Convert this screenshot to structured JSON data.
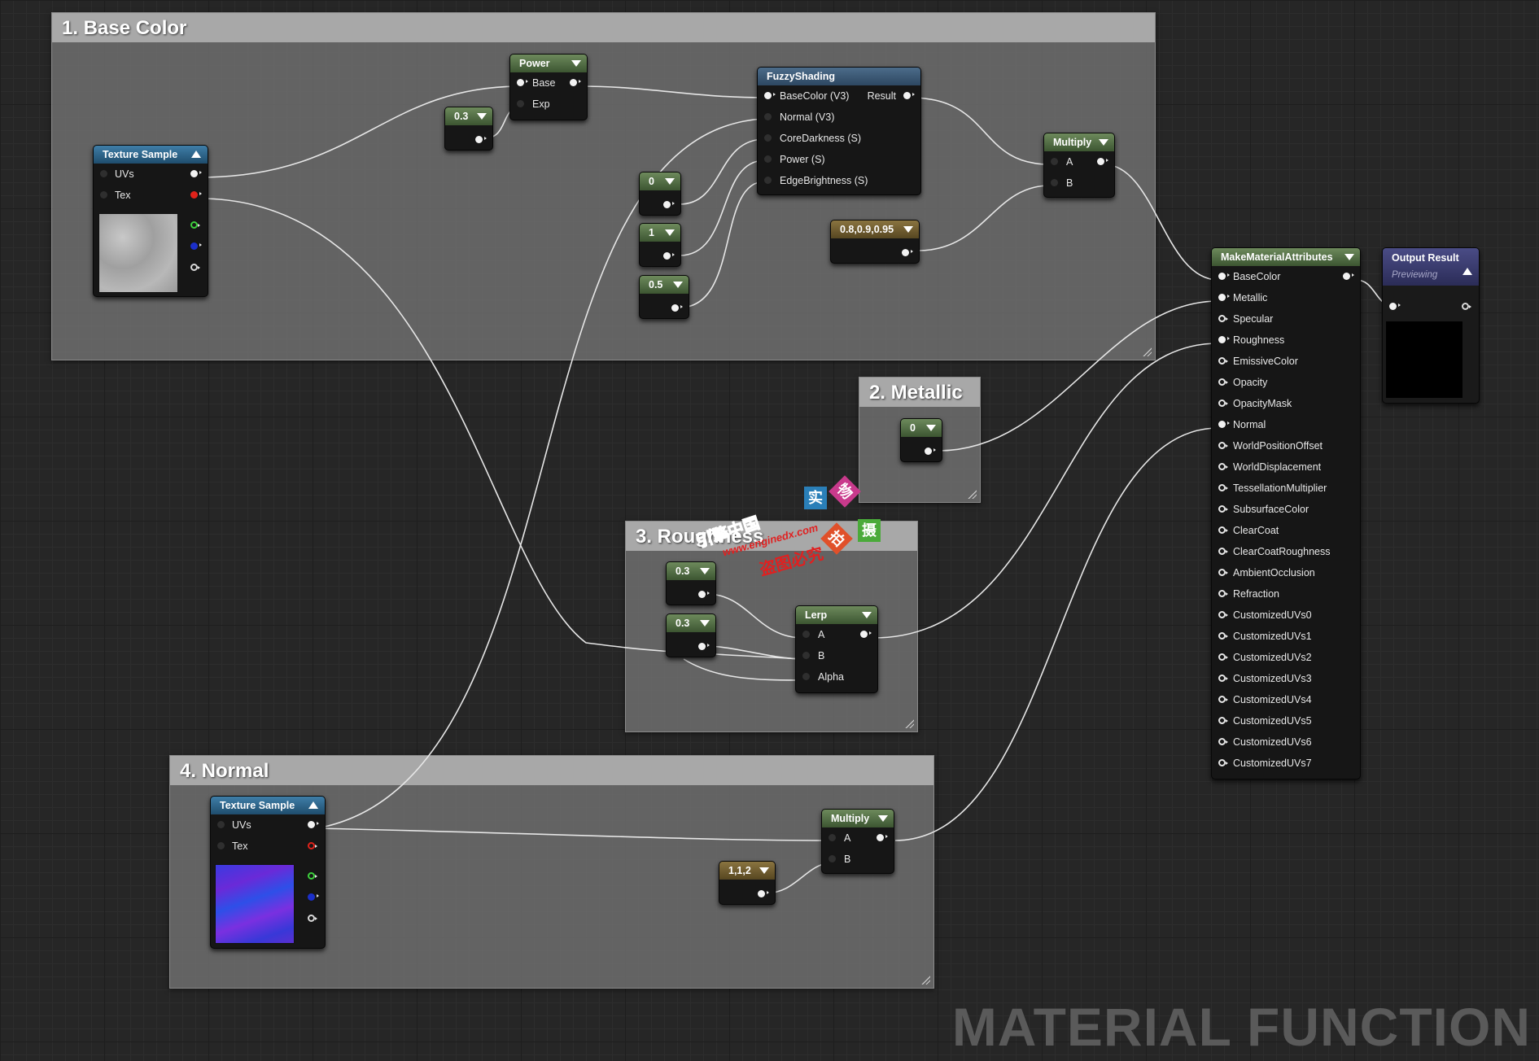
{
  "comments": {
    "base_color": "1. Base Color",
    "metallic": "2. Metallic",
    "roughness": "3. Roughness",
    "normal": "4. Normal"
  },
  "nodes": {
    "texture_sample_1": {
      "title": "Texture Sample",
      "pins": [
        "UVs",
        "Tex"
      ]
    },
    "power": {
      "title": "Power",
      "pins": [
        "Base",
        "Exp"
      ]
    },
    "const_03_a": {
      "value": "0.3"
    },
    "fuzzy_shading": {
      "title": "FuzzyShading",
      "pins": [
        "BaseColor (V3)",
        "Normal (V3)",
        "CoreDarkness (S)",
        "Power (S)",
        "EdgeBrightness (S)"
      ],
      "output": "Result"
    },
    "const_0": {
      "value": "0"
    },
    "const_1": {
      "value": "1"
    },
    "const_05": {
      "value": "0.5"
    },
    "vec3_color": {
      "value": "0.8,0.9,0.95"
    },
    "multiply_1": {
      "title": "Multiply",
      "pins": [
        "A",
        "B"
      ]
    },
    "metallic_const": {
      "value": "0"
    },
    "rough_const_a": {
      "value": "0.3"
    },
    "rough_const_b": {
      "value": "0.3"
    },
    "lerp": {
      "title": "Lerp",
      "pins": [
        "A",
        "B",
        "Alpha"
      ]
    },
    "texture_sample_2": {
      "title": "Texture Sample",
      "pins": [
        "UVs",
        "Tex"
      ]
    },
    "vec3_112": {
      "value": "1,1,2"
    },
    "multiply_2": {
      "title": "Multiply",
      "pins": [
        "A",
        "B"
      ]
    },
    "make_material_attributes": {
      "title": "MakeMaterialAttributes",
      "pins": [
        "BaseColor",
        "Metallic",
        "Specular",
        "Roughness",
        "EmissiveColor",
        "Opacity",
        "OpacityMask",
        "Normal",
        "WorldPositionOffset",
        "WorldDisplacement",
        "TessellationMultiplier",
        "SubsurfaceColor",
        "ClearCoat",
        "ClearCoatRoughness",
        "AmbientOcclusion",
        "Refraction",
        "CustomizedUVs0",
        "CustomizedUVs1",
        "CustomizedUVs2",
        "CustomizedUVs3",
        "CustomizedUVs4",
        "CustomizedUVs5",
        "CustomizedUVs6",
        "CustomizedUVs7"
      ]
    },
    "output_result": {
      "title": "Output Result",
      "subtitle": "Previewing"
    }
  },
  "watermark": "MATERIAL FUNCTION",
  "stamps": {
    "site_cn": "引擎中国",
    "site_url": "www.enginedx.com",
    "warning": "盗图必究",
    "c1": "实",
    "c2": "物",
    "c3": "拍",
    "c4": "摄"
  },
  "colors": {
    "const_green": "#3c5531",
    "vector_gold": "#574721",
    "texture_blue": "#1f4d6d",
    "output_purple": "#2b2c57"
  }
}
